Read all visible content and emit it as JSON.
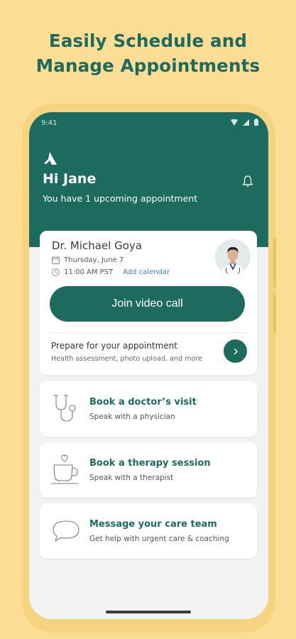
{
  "headline": {
    "line1": "Easily Schedule and",
    "line2": "Manage Appointments"
  },
  "status_bar": {
    "time": "9:41",
    "icons": [
      "wifi-icon",
      "signal-icon",
      "battery-icon"
    ]
  },
  "header": {
    "greeting": "Hi Jane",
    "subtitle": "You have 1 upcoming appointment",
    "icon": "bell-icon"
  },
  "appointment": {
    "doctor": "Dr. Michael Goya",
    "date": "Thursday, June 7",
    "time": "11:00 AM PST",
    "add_calendar": "Add calendar",
    "join_label": "Join video call",
    "prepare_title": "Prepare for your appointment",
    "prepare_sub": "Health assessment, photo upload, and more"
  },
  "actions": [
    {
      "title": "Book a doctor’s visit",
      "subtitle": "Speak with a physician",
      "icon": "stethoscope-icon"
    },
    {
      "title": "Book a therapy session",
      "subtitle": "Speak with a therapist",
      "icon": "coffee-cup-icon"
    },
    {
      "title": "Message your care team",
      "subtitle": "Get help with urgent care & coaching",
      "icon": "chat-bubble-icon"
    }
  ],
  "colors": {
    "background": "#FBDE94",
    "brand_green": "#1D6B5E",
    "link_blue": "#3A7FC1"
  }
}
